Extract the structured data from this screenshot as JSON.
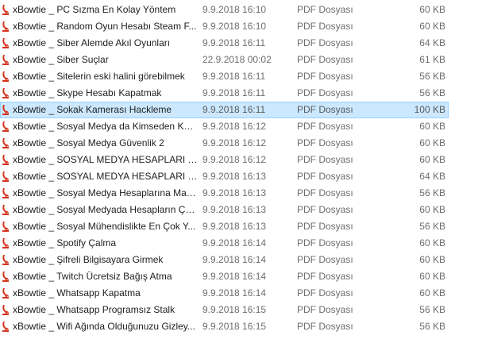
{
  "file_list": {
    "icon": "pdf-file-icon",
    "accent_color": "#d4341f",
    "selected_index": 6,
    "rows": [
      {
        "name": "xBowtie _ PC Sızma En Kolay Yöntem",
        "date": "9.9.2018 16:10",
        "type": "PDF Dosyası",
        "size": "60 KB"
      },
      {
        "name": "xBowtie _ Random Oyun Hesabı Steam F...",
        "date": "9.9.2018 16:10",
        "type": "PDF Dosyası",
        "size": "60 KB"
      },
      {
        "name": "xBowtie _ Siber Alemde Akıl Oyunları",
        "date": "9.9.2018 16:11",
        "type": "PDF Dosyası",
        "size": "64 KB"
      },
      {
        "name": "xBowtie _ Siber Suçlar",
        "date": "22.9.2018 00:02",
        "type": "PDF Dosyası",
        "size": "61 KB"
      },
      {
        "name": "xBowtie _ Sitelerin eski halini görebilmek",
        "date": "9.9.2018 16:11",
        "type": "PDF Dosyası",
        "size": "56 KB"
      },
      {
        "name": "xBowtie _ Skype Hesabı Kapatmak",
        "date": "9.9.2018 16:11",
        "type": "PDF Dosyası",
        "size": "56 KB"
      },
      {
        "name": "xBowtie _ Sokak Kamerası Hackleme",
        "date": "9.9.2018 16:11",
        "type": "PDF Dosyası",
        "size": "100 KB"
      },
      {
        "name": "xBowtie _ Sosyal Medya da Kimseden Kor...",
        "date": "9.9.2018 16:12",
        "type": "PDF Dosyası",
        "size": "60 KB"
      },
      {
        "name": "xBowtie _ Sosyal Medya Güvenlik 2",
        "date": "9.9.2018 16:12",
        "type": "PDF Dosyası",
        "size": "60 KB"
      },
      {
        "name": "xBowtie _ SOSYAL MEDYA HESAPLARI Ç...",
        "date": "9.9.2018 16:12",
        "type": "PDF Dosyası",
        "size": "60 KB"
      },
      {
        "name": "xBowtie _ SOSYAL MEDYA HESAPLARI H...",
        "date": "9.9.2018 16:13",
        "type": "PDF Dosyası",
        "size": "64 KB"
      },
      {
        "name": "xBowtie _ Sosyal Medya Hesaplarına Mav...",
        "date": "9.9.2018 16:13",
        "type": "PDF Dosyası",
        "size": "56 KB"
      },
      {
        "name": "xBowtie _ Sosyal Medyada Hesapların Çal...",
        "date": "9.9.2018 16:13",
        "type": "PDF Dosyası",
        "size": "60 KB"
      },
      {
        "name": "xBowtie _ Sosyal Mühendislikte En Çok Y...",
        "date": "9.9.2018 16:13",
        "type": "PDF Dosyası",
        "size": "56 KB"
      },
      {
        "name": "xBowtie _ Spotify Çalma",
        "date": "9.9.2018 16:14",
        "type": "PDF Dosyası",
        "size": "60 KB"
      },
      {
        "name": "xBowtie _ Şifreli Bilgisayara Girmek",
        "date": "9.9.2018 16:14",
        "type": "PDF Dosyası",
        "size": "60 KB"
      },
      {
        "name": "xBowtie _ Twitch Ücretsiz Bağış Atma",
        "date": "9.9.2018 16:14",
        "type": "PDF Dosyası",
        "size": "60 KB"
      },
      {
        "name": "xBowtie _ Whatsapp Kapatma",
        "date": "9.9.2018 16:14",
        "type": "PDF Dosyası",
        "size": "60 KB"
      },
      {
        "name": "xBowtie _ Whatsapp Programsız Stalk",
        "date": "9.9.2018 16:15",
        "type": "PDF Dosyası",
        "size": "56 KB"
      },
      {
        "name": "xBowtie _ Wifi Ağında Olduğunuzu Gizley...",
        "date": "9.9.2018 16:15",
        "type": "PDF Dosyası",
        "size": "56 KB"
      }
    ]
  }
}
